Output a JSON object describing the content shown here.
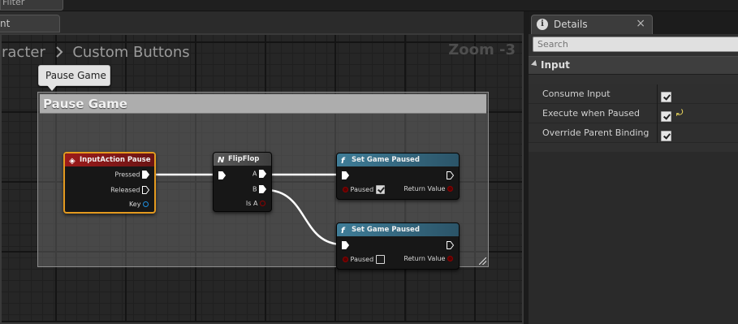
{
  "top": {
    "filter_text": "Filter"
  },
  "graph_tab": {
    "label": "nt"
  },
  "graph": {
    "breadcrumb": [
      "racter",
      "Custom Buttons"
    ],
    "zoom": "Zoom -3",
    "comment": {
      "bubble": "Pause Game",
      "title": "Pause Game"
    },
    "nodes": {
      "input_action": {
        "title": "InputAction Pause",
        "pins": [
          "Pressed",
          "Released",
          "Key"
        ]
      },
      "flipflop": {
        "title": "FlipFlop",
        "pins": [
          "A",
          "B",
          "Is A"
        ]
      },
      "set_paused_1": {
        "title": "Set Game Paused",
        "paused_label": "Paused",
        "paused_value": true,
        "return_label": "Return Value"
      },
      "set_paused_2": {
        "title": "Set Game Paused",
        "paused_label": "Paused",
        "paused_value": false,
        "return_label": "Return Value"
      }
    },
    "colors": {
      "exec_wire": "#ffffff",
      "event_header": "#9c1b1b",
      "function_header": "#3f7d98",
      "selection": "#e49a1f",
      "bool_pin": "#8c0000",
      "struct_pin": "#1e8fe0"
    }
  },
  "details": {
    "tab_title": "Details",
    "close_label": "×",
    "search_placeholder": "Search",
    "category": "Input",
    "properties": [
      {
        "label": "Consume Input",
        "checked": true
      },
      {
        "label": "Execute when Paused",
        "checked": true,
        "has_reset": true
      },
      {
        "label": "Override Parent Binding",
        "checked": true
      }
    ]
  }
}
